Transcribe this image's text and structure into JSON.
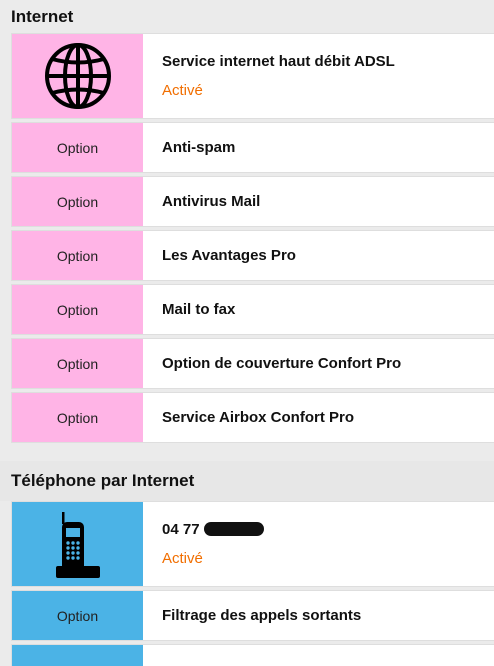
{
  "internet": {
    "title": "Internet",
    "main": {
      "icon": "globe-icon",
      "service": "Service internet haut débit ADSL",
      "status": "Activé"
    },
    "options": [
      {
        "tag": "Option",
        "label": "Anti-spam"
      },
      {
        "tag": "Option",
        "label": "Antivirus Mail"
      },
      {
        "tag": "Option",
        "label": "Les Avantages Pro"
      },
      {
        "tag": "Option",
        "label": "Mail to fax"
      },
      {
        "tag": "Option",
        "label": "Option de couverture Confort Pro"
      },
      {
        "tag": "Option",
        "label": "Service Airbox Confort Pro"
      }
    ]
  },
  "telephone": {
    "title": "Téléphone par Internet",
    "main": {
      "icon": "cordless-phone-icon",
      "number": "04 77",
      "status": "Activé"
    },
    "options": [
      {
        "tag": "Option",
        "label": "Filtrage des appels sortants"
      }
    ]
  },
  "colors": {
    "internet_accent": "#ffb4e6",
    "telephone_accent": "#4bb3e6",
    "status": "#f16e00"
  }
}
